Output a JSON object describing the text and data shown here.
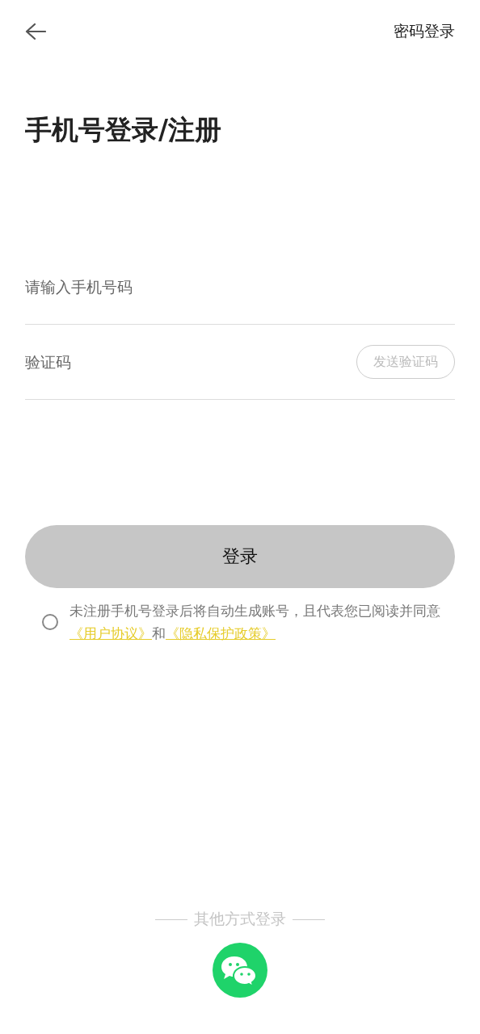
{
  "header": {
    "action": "密码登录"
  },
  "title": "手机号登录/注册",
  "fields": [
    {
      "kind": "phone",
      "placeholder": "请输入手机号码"
    },
    {
      "kind": "code",
      "placeholder": "验证码",
      "button": {
        "label": "发送验证码",
        "disabled": true
      }
    }
  ],
  "login_button": {
    "label": "登录",
    "disabled": true
  },
  "agreement": {
    "checked": false,
    "text_before": "未注册手机号登录后将自动生成账号，且代表您已阅读并同意",
    "links": [
      "《用户协议》",
      "《隐私保护政策》"
    ],
    "joiner": "和"
  },
  "other_login": {
    "label": "其他方式登录"
  }
}
